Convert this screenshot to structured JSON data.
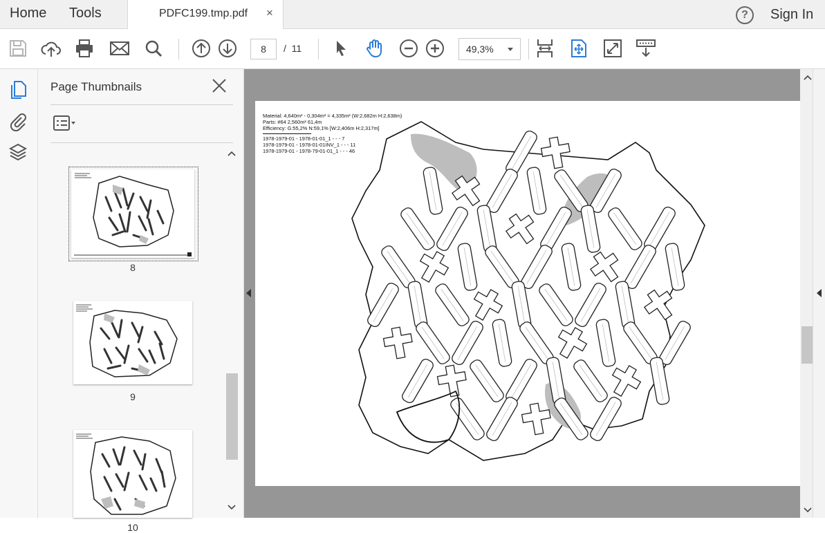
{
  "menu": {
    "home": "Home",
    "tools": "Tools"
  },
  "tab": {
    "filename": "PDFC199.tmp.pdf",
    "close": "×"
  },
  "account": {
    "help": "?",
    "sign_in": "Sign In"
  },
  "toolbar": {
    "icons": [
      "save-icon",
      "upload-icon",
      "print-icon",
      "email-icon",
      "search-icon",
      "prev-page-icon",
      "next-page-icon",
      "select-cursor-icon",
      "hand-tool-icon",
      "zoom-out-icon",
      "zoom-in-icon",
      "fit-width-icon",
      "fit-page-icon",
      "fullscreen-icon",
      "read-mode-icon"
    ],
    "current_page": "8",
    "page_separator": "/",
    "total_pages": "11",
    "zoom": "49,3%"
  },
  "sidebar": {
    "title": "Page Thumbnails",
    "thumbnails": [
      {
        "label": "8",
        "selected": true
      },
      {
        "label": "9",
        "selected": false
      },
      {
        "label": "10",
        "selected": false
      }
    ]
  },
  "document": {
    "info_lines": [
      "Material: 4,640m² - 0,304m² = 4,335m² (W:2,682m H:2,638m)",
      "Parts: #64   2,560m² 61,4m",
      "Efficiency: G:55,2% N:59,1% [W:2,406m H:2,317m]"
    ],
    "part_lines": [
      "1978-1979-01 - 1978-01-01_1 - - - 7",
      "1978-1979-01 - 1978-01-01INV_1 - - - 11",
      "1978-1979-01 - 1978-79-01-01_1 - - - 46"
    ]
  },
  "colors": {
    "accent": "#2b7bd9",
    "doc_bg": "#969696",
    "defect": "#bdbdbd"
  }
}
